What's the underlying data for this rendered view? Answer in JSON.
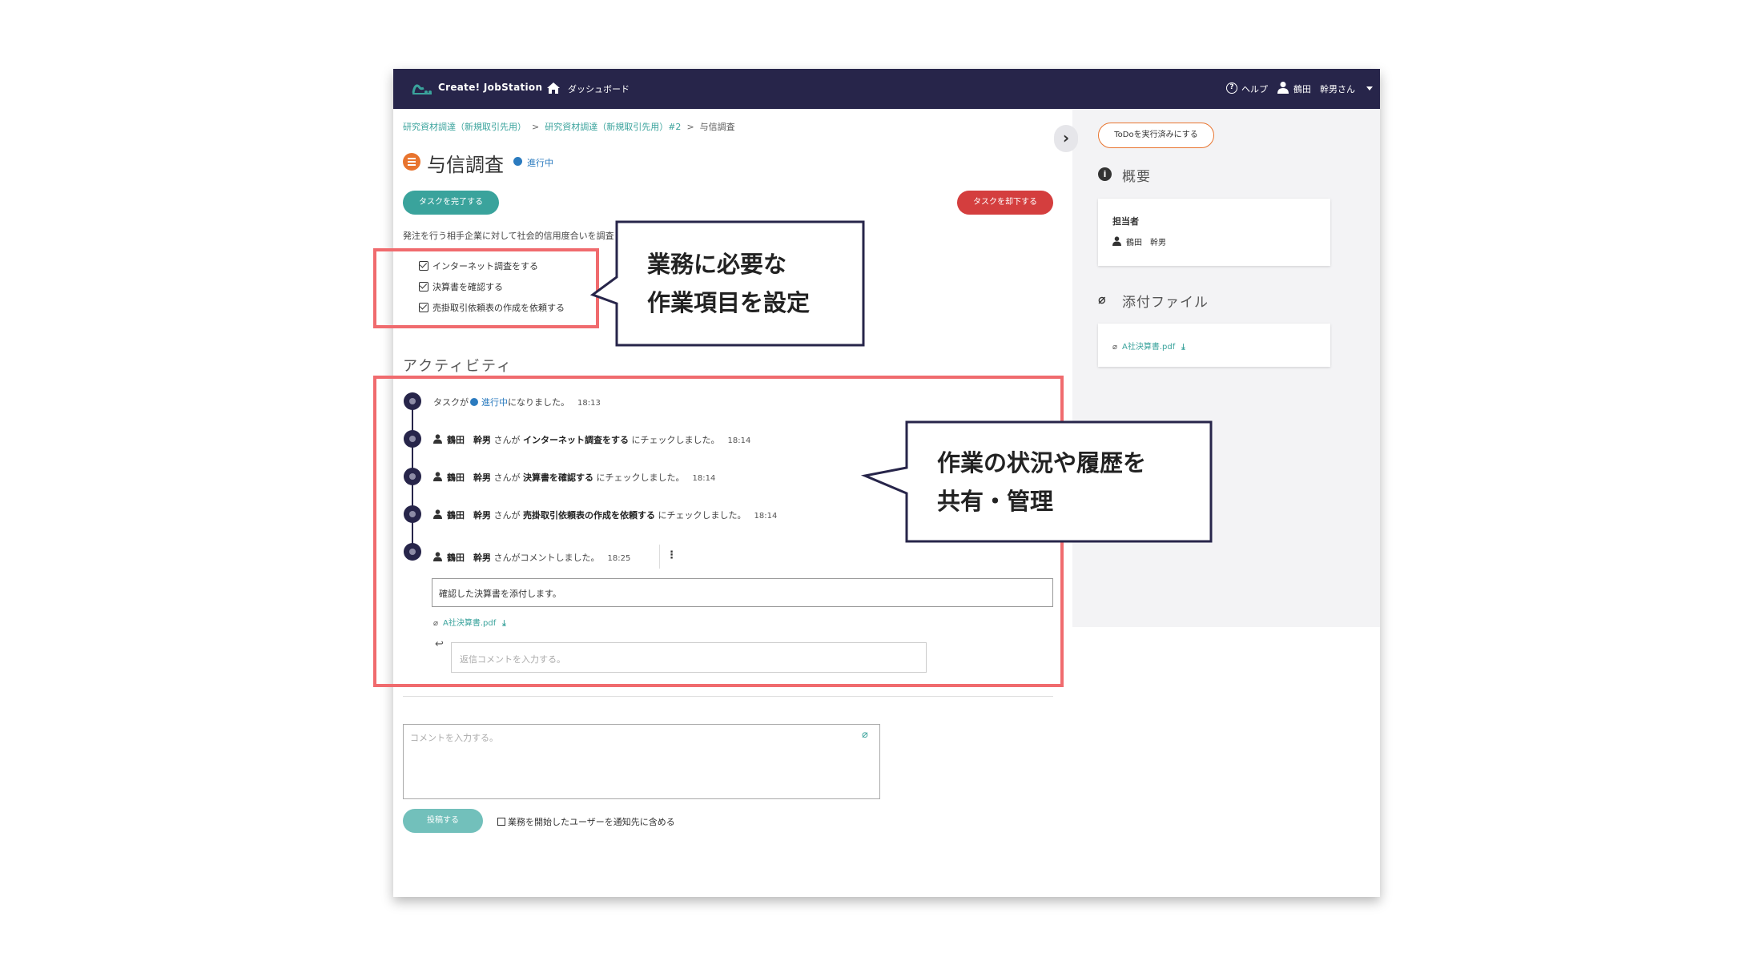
{
  "app": {
    "brand": "Create! JobStation",
    "dashboard": "ダッシュボード",
    "help": "ヘルプ",
    "user": "鶴田　幹男さん"
  },
  "breadcrumb": [
    "研究資材調達（新規取引先用）",
    "研究資材調達（新規取引先用）#2",
    "与信調査"
  ],
  "task": {
    "title": "与信調査",
    "status": "進行中",
    "complete_button": "タスクを完了する",
    "reject_button": "タスクを却下する",
    "description": "発注を行う相手企業に対して社会的信用度合いを調査",
    "checklist": [
      {
        "label": "インターネット調査をする",
        "checked": true
      },
      {
        "label": "決算書を確認する",
        "checked": true
      },
      {
        "label": "売掛取引依頼表の作成を依頼する",
        "checked": true
      }
    ]
  },
  "activity": {
    "title": "アクティビティ",
    "entry1": {
      "prefix": "タスクが",
      "status": "進行中",
      "suffix": "になりました。",
      "time": "18:13"
    },
    "entry2": {
      "user": "鶴田　幹男",
      "mid": "さんが",
      "item": "インターネット調査をする",
      "suffix": "にチェックしました。",
      "time": "18:14"
    },
    "entry3": {
      "user": "鶴田　幹男",
      "mid": "さんが",
      "item": "決算書を確認する",
      "suffix": "にチェックしました。",
      "time": "18:14"
    },
    "entry4": {
      "user": "鶴田　幹男",
      "mid": "さんが",
      "item": "売掛取引依頼表の作成を依頼する",
      "suffix": "にチェックしました。",
      "time": "18:14"
    },
    "entry5": {
      "user": "鶴田　幹男",
      "suffix": "さんがコメントしました。",
      "time": "18:25"
    },
    "comment": "確認した決算書を添付します。",
    "attachment": "A社決算書.pdf",
    "reply_placeholder": "返信コメントを入力する。"
  },
  "composer": {
    "placeholder": "コメントを入力する。",
    "post_button": "投稿する",
    "notify_label": "業務を開始したユーザーを通知先に含める"
  },
  "sidebar": {
    "todo_button": "ToDoを実行済みにする",
    "overview_heading": "概要",
    "assignee_label": "担当者",
    "assignee": "鶴田　幹男",
    "attachments_heading": "添付ファイル",
    "attachment": "A社決算書.pdf"
  },
  "callouts": {
    "left_line1": "業務に必要な",
    "left_line2": "作業項目を設定",
    "right_line1": "作業の状況や履歴を",
    "right_line2": "共有・管理"
  },
  "colors": {
    "topbar": "#27254a",
    "accent_teal": "#3aa39c",
    "danger": "#d43e3e",
    "highlight": "#f06b6e",
    "status_blue": "#2b7bbf"
  }
}
